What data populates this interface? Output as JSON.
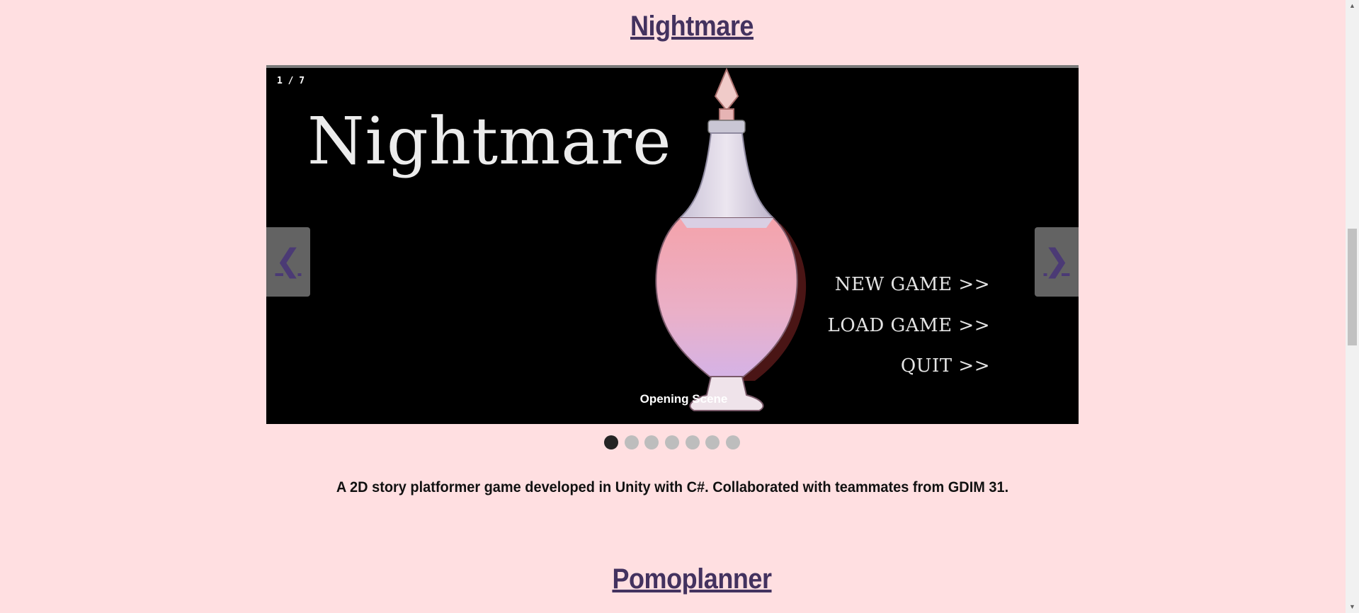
{
  "projects": [
    {
      "title": "Nightmare",
      "slideshow": {
        "counter": "1 / 7",
        "current_slide": 1,
        "total_slides": 7,
        "caption": "Opening Scene",
        "game_logo": "Nightmare",
        "menu": [
          "NEW GAME >>",
          "LOAD GAME >>",
          "QUIT >>"
        ],
        "prev_label": "❮",
        "next_label": "❯"
      },
      "description": "A 2D story platformer game developed in Unity with C#. Collaborated with teammates from GDIM 31."
    },
    {
      "title": "Pomoplanner"
    }
  ],
  "colors": {
    "background": "#ffdfe1",
    "title": "#43325f",
    "active_dot": "#242424",
    "inactive_dot": "#bdbdbd"
  },
  "scrollbar": {
    "up_icon": "triangle-up-icon",
    "down_icon": "triangle-down-icon"
  }
}
